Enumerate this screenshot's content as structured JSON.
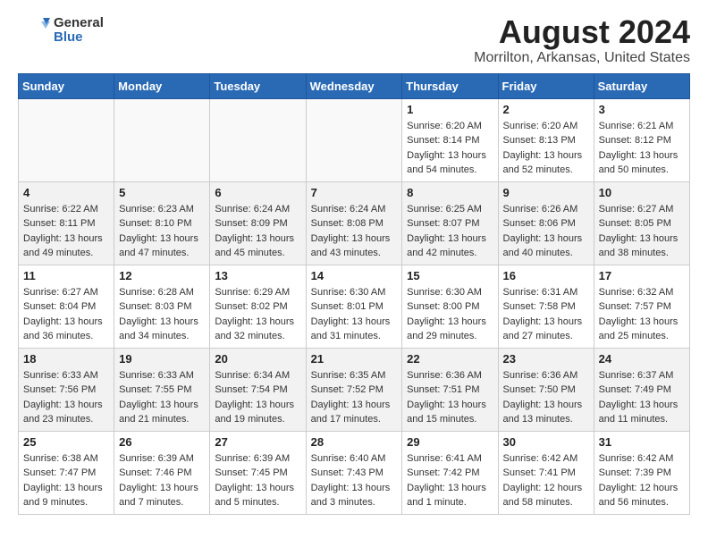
{
  "logo": {
    "general": "General",
    "blue": "Blue"
  },
  "title": "August 2024",
  "subtitle": "Morrilton, Arkansas, United States",
  "days_of_week": [
    "Sunday",
    "Monday",
    "Tuesday",
    "Wednesday",
    "Thursday",
    "Friday",
    "Saturday"
  ],
  "weeks": [
    [
      {
        "day": "",
        "info": ""
      },
      {
        "day": "",
        "info": ""
      },
      {
        "day": "",
        "info": ""
      },
      {
        "day": "",
        "info": ""
      },
      {
        "day": "1",
        "info": "Sunrise: 6:20 AM\nSunset: 8:14 PM\nDaylight: 13 hours\nand 54 minutes."
      },
      {
        "day": "2",
        "info": "Sunrise: 6:20 AM\nSunset: 8:13 PM\nDaylight: 13 hours\nand 52 minutes."
      },
      {
        "day": "3",
        "info": "Sunrise: 6:21 AM\nSunset: 8:12 PM\nDaylight: 13 hours\nand 50 minutes."
      }
    ],
    [
      {
        "day": "4",
        "info": "Sunrise: 6:22 AM\nSunset: 8:11 PM\nDaylight: 13 hours\nand 49 minutes."
      },
      {
        "day": "5",
        "info": "Sunrise: 6:23 AM\nSunset: 8:10 PM\nDaylight: 13 hours\nand 47 minutes."
      },
      {
        "day": "6",
        "info": "Sunrise: 6:24 AM\nSunset: 8:09 PM\nDaylight: 13 hours\nand 45 minutes."
      },
      {
        "day": "7",
        "info": "Sunrise: 6:24 AM\nSunset: 8:08 PM\nDaylight: 13 hours\nand 43 minutes."
      },
      {
        "day": "8",
        "info": "Sunrise: 6:25 AM\nSunset: 8:07 PM\nDaylight: 13 hours\nand 42 minutes."
      },
      {
        "day": "9",
        "info": "Sunrise: 6:26 AM\nSunset: 8:06 PM\nDaylight: 13 hours\nand 40 minutes."
      },
      {
        "day": "10",
        "info": "Sunrise: 6:27 AM\nSunset: 8:05 PM\nDaylight: 13 hours\nand 38 minutes."
      }
    ],
    [
      {
        "day": "11",
        "info": "Sunrise: 6:27 AM\nSunset: 8:04 PM\nDaylight: 13 hours\nand 36 minutes."
      },
      {
        "day": "12",
        "info": "Sunrise: 6:28 AM\nSunset: 8:03 PM\nDaylight: 13 hours\nand 34 minutes."
      },
      {
        "day": "13",
        "info": "Sunrise: 6:29 AM\nSunset: 8:02 PM\nDaylight: 13 hours\nand 32 minutes."
      },
      {
        "day": "14",
        "info": "Sunrise: 6:30 AM\nSunset: 8:01 PM\nDaylight: 13 hours\nand 31 minutes."
      },
      {
        "day": "15",
        "info": "Sunrise: 6:30 AM\nSunset: 8:00 PM\nDaylight: 13 hours\nand 29 minutes."
      },
      {
        "day": "16",
        "info": "Sunrise: 6:31 AM\nSunset: 7:58 PM\nDaylight: 13 hours\nand 27 minutes."
      },
      {
        "day": "17",
        "info": "Sunrise: 6:32 AM\nSunset: 7:57 PM\nDaylight: 13 hours\nand 25 minutes."
      }
    ],
    [
      {
        "day": "18",
        "info": "Sunrise: 6:33 AM\nSunset: 7:56 PM\nDaylight: 13 hours\nand 23 minutes."
      },
      {
        "day": "19",
        "info": "Sunrise: 6:33 AM\nSunset: 7:55 PM\nDaylight: 13 hours\nand 21 minutes."
      },
      {
        "day": "20",
        "info": "Sunrise: 6:34 AM\nSunset: 7:54 PM\nDaylight: 13 hours\nand 19 minutes."
      },
      {
        "day": "21",
        "info": "Sunrise: 6:35 AM\nSunset: 7:52 PM\nDaylight: 13 hours\nand 17 minutes."
      },
      {
        "day": "22",
        "info": "Sunrise: 6:36 AM\nSunset: 7:51 PM\nDaylight: 13 hours\nand 15 minutes."
      },
      {
        "day": "23",
        "info": "Sunrise: 6:36 AM\nSunset: 7:50 PM\nDaylight: 13 hours\nand 13 minutes."
      },
      {
        "day": "24",
        "info": "Sunrise: 6:37 AM\nSunset: 7:49 PM\nDaylight: 13 hours\nand 11 minutes."
      }
    ],
    [
      {
        "day": "25",
        "info": "Sunrise: 6:38 AM\nSunset: 7:47 PM\nDaylight: 13 hours\nand 9 minutes."
      },
      {
        "day": "26",
        "info": "Sunrise: 6:39 AM\nSunset: 7:46 PM\nDaylight: 13 hours\nand 7 minutes."
      },
      {
        "day": "27",
        "info": "Sunrise: 6:39 AM\nSunset: 7:45 PM\nDaylight: 13 hours\nand 5 minutes."
      },
      {
        "day": "28",
        "info": "Sunrise: 6:40 AM\nSunset: 7:43 PM\nDaylight: 13 hours\nand 3 minutes."
      },
      {
        "day": "29",
        "info": "Sunrise: 6:41 AM\nSunset: 7:42 PM\nDaylight: 13 hours\nand 1 minute."
      },
      {
        "day": "30",
        "info": "Sunrise: 6:42 AM\nSunset: 7:41 PM\nDaylight: 12 hours\nand 58 minutes."
      },
      {
        "day": "31",
        "info": "Sunrise: 6:42 AM\nSunset: 7:39 PM\nDaylight: 12 hours\nand 56 minutes."
      }
    ]
  ]
}
